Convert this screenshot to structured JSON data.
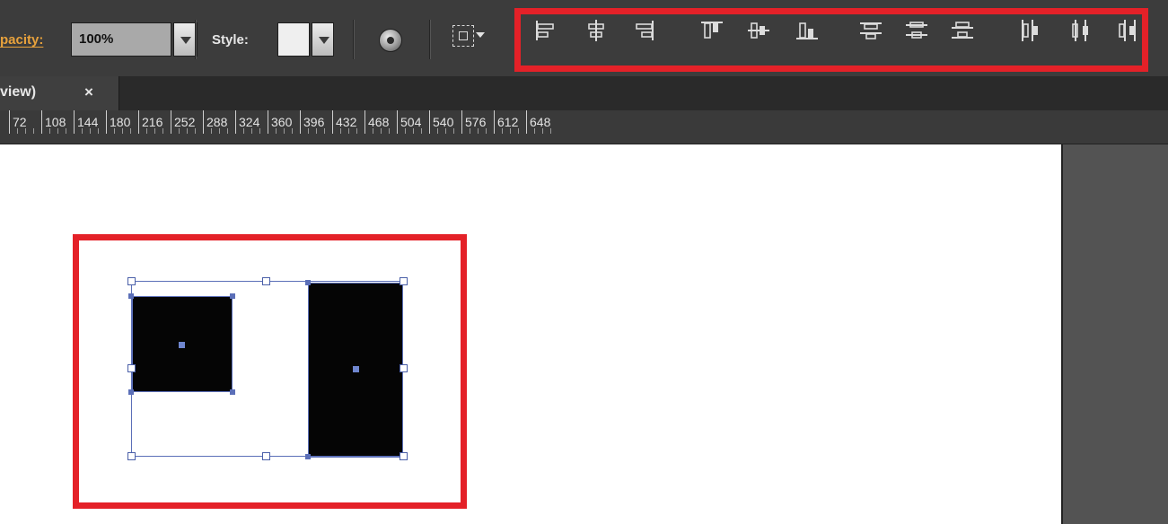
{
  "control_bar": {
    "opacity_label": "pacity:",
    "opacity_value": "100%",
    "style_label": "Style:",
    "style_swatch_color": "#efefef",
    "recolor_icon": "recolor-artwork-icon",
    "isolate_icon": "isolate-group-icon",
    "align_buttons": [
      {
        "name": "align-left-icon"
      },
      {
        "name": "align-horizontal-center-icon"
      },
      {
        "name": "align-right-icon"
      },
      {
        "name": "align-top-icon"
      },
      {
        "name": "align-vertical-center-icon"
      },
      {
        "name": "align-bottom-icon"
      },
      {
        "name": "distribute-top-icon"
      },
      {
        "name": "distribute-vertical-center-icon"
      },
      {
        "name": "distribute-bottom-icon"
      },
      {
        "name": "distribute-left-icon"
      },
      {
        "name": "distribute-horizontal-center-icon"
      },
      {
        "name": "distribute-right-icon"
      }
    ]
  },
  "document_tab": {
    "title": "view)",
    "close": "×"
  },
  "ruler": {
    "labels": [
      "72",
      "108",
      "144",
      "180",
      "216",
      "252",
      "288",
      "324",
      "360",
      "396",
      "432",
      "468",
      "504",
      "540",
      "576",
      "612",
      "648"
    ]
  },
  "colors": {
    "highlight": "#e42128",
    "selection": "#5b6fb8",
    "ui_dark": "#3c3c3c",
    "accent_label": "#e8a23c"
  }
}
